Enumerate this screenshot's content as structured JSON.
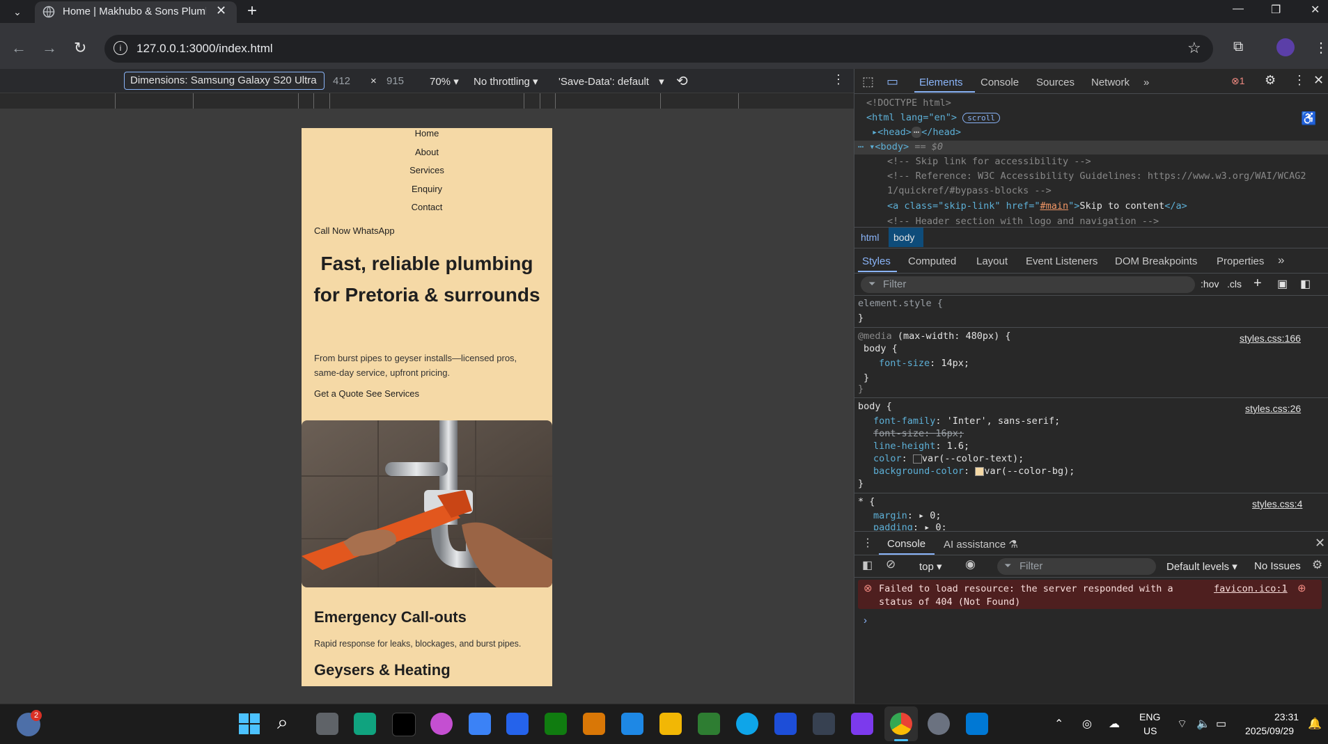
{
  "browser": {
    "tab_title": "Home | Makhubo & Sons Plumb",
    "url": "127.0.0.1:3000/index.html"
  },
  "device_toolbar": {
    "dimensions": "Dimensions: Samsung Galaxy S20 Ultra",
    "width": "412",
    "times": "×",
    "height": "915",
    "zoom": "70%",
    "throttling": "No throttling",
    "save_data": "'Save-Data': default"
  },
  "page": {
    "nav": [
      "Home",
      "About",
      "Services",
      "Enquiry",
      "Contact"
    ],
    "call_links": "Call Now WhatsApp",
    "hero_title": "Fast, reliable plumbing for Pretoria & surrounds",
    "hero_subtitle": "From burst pipes to geyser installs—licensed pros, same-day service, upfront pricing.",
    "hero_ctas": "Get a Quote See Services",
    "section1_title": "Emergency Call-outs",
    "section1_text": "Rapid response for leaks, blockages, and burst pipes.",
    "section2_title": "Geysers & Heating"
  },
  "devtools": {
    "tabs": [
      "Elements",
      "Console",
      "Sources",
      "Network"
    ],
    "error_count": "1",
    "dom": {
      "doctype": "<!DOCTYPE html>",
      "html_open": "<html lang=\"en\">",
      "scroll_badge": "scroll",
      "head": "<head>",
      "head_close": "</head>",
      "body": "<body>",
      "body_sel": "== $0",
      "comment1": "<!-- Skip link for accessibility -->",
      "comment2a": "<!-- Reference: W3C Accessibility Guidelines: https://www.w3.org/WAI/WCAG2",
      "comment2b": "1/quickref/#bypass-blocks -->",
      "skip_a_open": "<a class=\"skip-link\" href=\"",
      "skip_href": "#main",
      "skip_text": "Skip to content",
      "skip_a_close": "</a>",
      "comment3": "<!-- Header section with logo and navigation -->"
    },
    "breadcrumb": [
      "html",
      "body"
    ],
    "style_tabs": [
      "Styles",
      "Computed",
      "Layout",
      "Event Listeners",
      "DOM Breakpoints",
      "Properties"
    ],
    "filter_placeholder": "Filter",
    "hov": ":hov",
    "cls": ".cls",
    "styles": {
      "element_style": "element.style {",
      "close_brace": "}",
      "media": "@media",
      "media_query": "(max-width: 480px) {",
      "media_source": "styles.css:166",
      "body_sel": "body {",
      "font_size_14": "font-size",
      "font_size_14_val": "14px;",
      "body_source": "styles.css:26",
      "ff": "font-family",
      "ff_val": "'Inter', sans-serif;",
      "fs16": "font-size: 16px;",
      "lh": "line-height",
      "lh_val": "1.6;",
      "color": "color",
      "color_val": "var(--color-text);",
      "bg": "background-color",
      "bg_val": "var(--color-bg);",
      "star_sel": "* {",
      "star_source": "styles.css:4",
      "margin": "margin",
      "margin_val": "0;",
      "padding": "padding",
      "padding_val": "0;"
    },
    "console": {
      "tabs": [
        "Console",
        "AI assistance"
      ],
      "context": "top",
      "filter": "Filter",
      "levels": "Default levels",
      "issues": "No Issues",
      "error_line1": "Failed to load resource: the server responded with a",
      "error_line2": "status of 404 (Not Found)",
      "error_source": "favicon.ico:1"
    }
  },
  "taskbar": {
    "weather_badge": "2",
    "lang1": "ENG",
    "lang2": "US",
    "time": "23:31",
    "date": "2025/09/29"
  }
}
